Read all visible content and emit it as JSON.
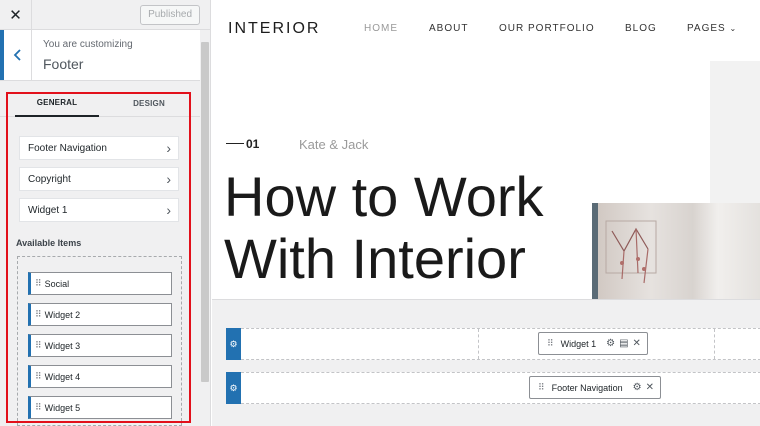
{
  "topbar": {
    "close_icon": "close-icon",
    "published_label": "Published"
  },
  "customizing": {
    "label": "You are customizing",
    "title": "Footer",
    "back_icon": "chevron-left-icon"
  },
  "tabs": {
    "general": "GENERAL",
    "design": "DESIGN"
  },
  "sections": [
    {
      "label": "Footer Navigation",
      "icon": "chevron-right-icon"
    },
    {
      "label": "Copyright",
      "icon": "chevron-right-icon"
    },
    {
      "label": "Widget 1",
      "icon": "chevron-right-icon"
    }
  ],
  "available": {
    "title": "Available Items",
    "items": [
      "Social",
      "Widget 2",
      "Widget 3",
      "Widget 4",
      "Widget 5"
    ]
  },
  "site": {
    "brand": "INTERIOR",
    "nav": [
      "HOME",
      "ABOUT",
      "OUR PORTFOLIO",
      "BLOG",
      "PAGES"
    ],
    "hero_number": "01",
    "hero_names": "Kate & Jack",
    "hero_title_line1": "How to Work",
    "hero_title_line2": "With Interior"
  },
  "builder": {
    "row1_item": "Widget 1",
    "row2_item": "Footer Navigation",
    "row_handle_icon": "gear-icon"
  },
  "colors": {
    "accent": "#2271b1",
    "highlight": "#e2101b"
  }
}
